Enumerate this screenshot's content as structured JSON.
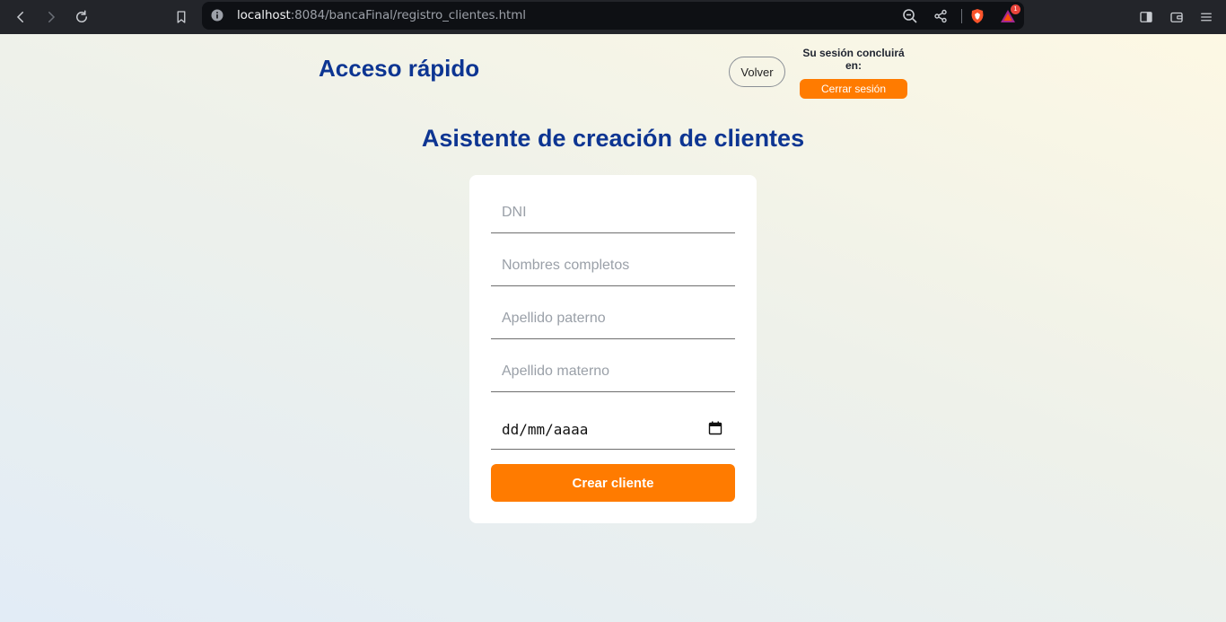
{
  "browser": {
    "url_host": "localhost",
    "url_rest": ":8084/bancaFinal/registro_clientes.html",
    "notification_count": "1"
  },
  "header": {
    "brand": "Acceso rápido",
    "back_label": "Volver",
    "session_text": "Su sesión concluirá en:",
    "logout_label": "Cerrar sesión"
  },
  "main": {
    "title": "Asistente de creación de clientes"
  },
  "form": {
    "dni_placeholder": "DNI",
    "names_placeholder": "Nombres completos",
    "paternal_placeholder": "Apellido paterno",
    "maternal_placeholder": "Apellido materno",
    "date_placeholder": "dd/mm/aaaa",
    "submit_label": "Crear cliente"
  },
  "colors": {
    "accent": "#ff7b00",
    "brand": "#0d3592"
  }
}
